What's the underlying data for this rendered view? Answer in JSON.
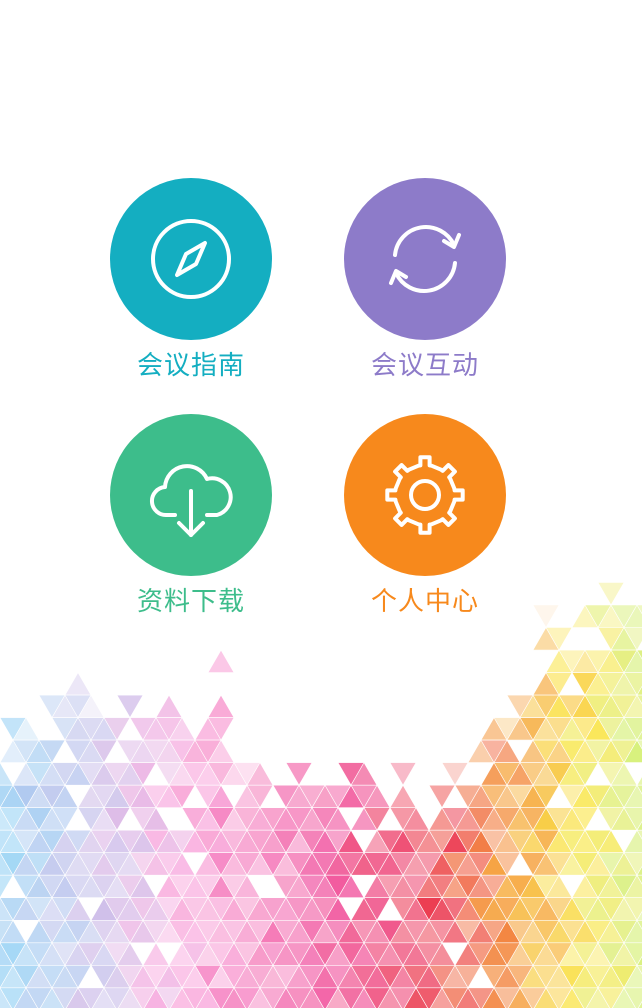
{
  "menu": [
    {
      "label": "会议指南",
      "color": "#14AEC1",
      "icon": "compass-icon"
    },
    {
      "label": "会议互动",
      "color": "#8D7BC9",
      "icon": "sync-icon"
    },
    {
      "label": "资料下载",
      "color": "#3DBD8B",
      "icon": "cloud-download-icon"
    },
    {
      "label": "个人中心",
      "color": "#F7891C",
      "icon": "gear-icon"
    }
  ]
}
